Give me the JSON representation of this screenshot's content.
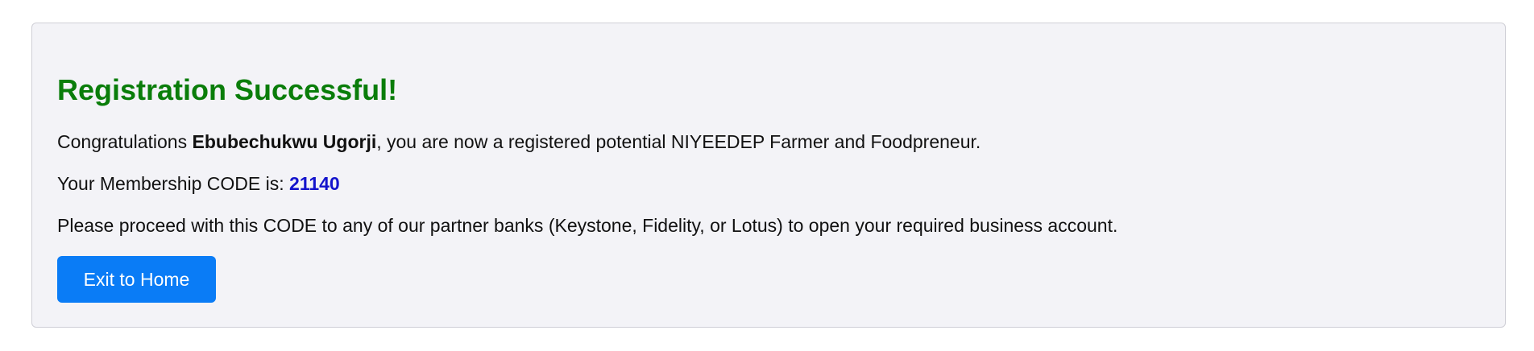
{
  "result": {
    "title": "Registration Successful!",
    "congrats_prefix": "Congratulations ",
    "user_name": "Ebubechukwu Ugorji",
    "congrats_suffix": ", you are now a registered potential NIYEEDEP Farmer and Foodpreneur.",
    "code_label": "Your Membership CODE is: ",
    "membership_code": "21140",
    "instructions": "Please proceed with this CODE to any of our partner banks (Keystone, Fidelity, or Lotus) to open your required business account.",
    "exit_button_label": "Exit to Home"
  },
  "colors": {
    "title": "#0a7d0a",
    "code": "#1414cc",
    "button": "#0a7cf6",
    "card_background": "#f3f3f7"
  }
}
